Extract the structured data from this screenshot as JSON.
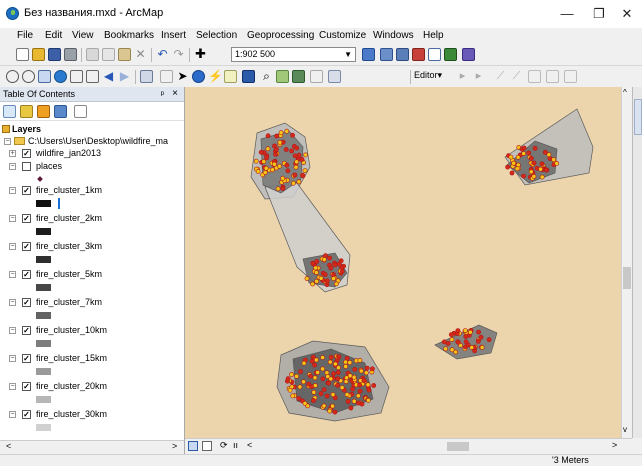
{
  "window": {
    "title": "Без названия.mxd - ArcMap",
    "minimize": "—",
    "restore": "❐",
    "close": "✕"
  },
  "menu": [
    "File",
    "Edit",
    "View",
    "Bookmarks",
    "Insert",
    "Selection",
    "Geoprocessing",
    "Customize",
    "Windows",
    "Help"
  ],
  "toolbar": {
    "scale": "1:902 500",
    "editor_label": "Editor▾"
  },
  "toc": {
    "title": "Table Of Contents",
    "pin": "ᵖ",
    "close": "×",
    "layers_label": "Layers",
    "path_label": "C:\\Users\\User\\Desktop\\wildfire_ma",
    "layers": [
      {
        "name": "wildfire_jan2013",
        "checked": true,
        "expand": "+",
        "symbol": "none"
      },
      {
        "name": "places",
        "checked": false,
        "expand": "−",
        "symbol": "point",
        "color": "#5a1a3a"
      },
      {
        "name": "fire_cluster_1km",
        "checked": true,
        "expand": "−",
        "symbol": "fill",
        "color": "#101010",
        "selected_accent": "#1a6fd6"
      },
      {
        "name": "fire_cluster_2km",
        "checked": true,
        "expand": "−",
        "symbol": "fill",
        "color": "#1c1c1c"
      },
      {
        "name": "fire_cluster_3km",
        "checked": true,
        "expand": "−",
        "symbol": "fill",
        "color": "#2e2e2e"
      },
      {
        "name": "fire_cluster_5km",
        "checked": true,
        "expand": "−",
        "symbol": "fill",
        "color": "#474747"
      },
      {
        "name": "fire_cluster_7km",
        "checked": true,
        "expand": "−",
        "symbol": "fill",
        "color": "#626262"
      },
      {
        "name": "fire_cluster_10km",
        "checked": true,
        "expand": "−",
        "symbol": "fill",
        "color": "#7d7d7d"
      },
      {
        "name": "fire_cluster_15km",
        "checked": true,
        "expand": "−",
        "symbol": "fill",
        "color": "#9a9a9a"
      },
      {
        "name": "fire_cluster_20km",
        "checked": true,
        "expand": "−",
        "symbol": "fill",
        "color": "#b6b6b6"
      },
      {
        "name": "fire_cluster_30km",
        "checked": true,
        "expand": "−",
        "symbol": "fill",
        "color": "#d0d0d0"
      }
    ]
  },
  "map": {
    "background": "#ecd5ac",
    "fire_point_fill": "#f5c518",
    "fire_point_stroke": "#b01515"
  },
  "scrollbars": {
    "left_arrow": "<",
    "right_arrow": ">",
    "up_arrow": "^",
    "down_arrow": "v"
  },
  "map_bottom": {
    "refresh": "⟳",
    "pause": "ıı",
    "back": "<"
  },
  "status": {
    "units": "'3 Meters"
  }
}
